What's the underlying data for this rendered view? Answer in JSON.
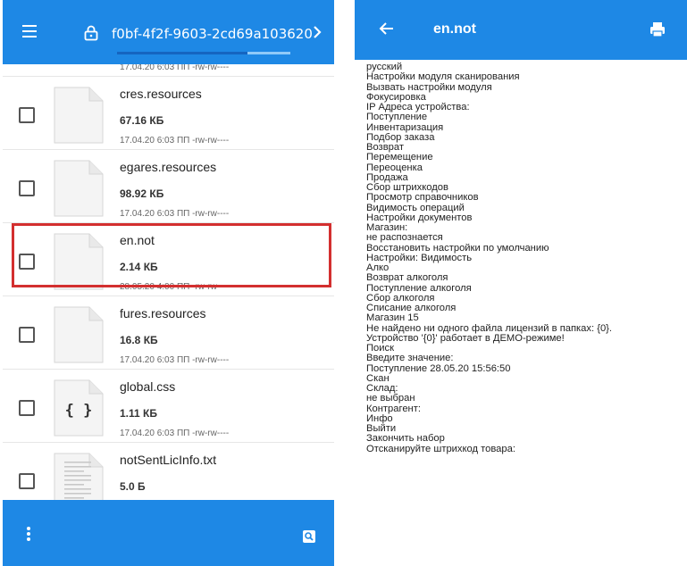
{
  "left_panel": {
    "path_text": "f0bf-4f2f-9603-2cd69a103620",
    "load_progress": 0.75,
    "partial_top_meta": "17.04.20 6:03 ПП  -rw-rw----",
    "files": [
      {
        "name": "cres.resources",
        "size": "67.16 КБ",
        "meta": "17.04.20 6:03 ПП  -rw-rw----",
        "icon": "blank-file-icon"
      },
      {
        "name": "egares.resources",
        "size": "98.92 КБ",
        "meta": "17.04.20 6:03 ПП  -rw-rw----",
        "icon": "blank-file-icon"
      },
      {
        "name": "en.not",
        "size": "2.14 КБ",
        "meta": "28.05.20 4:00 ПП  -rw-rw----",
        "icon": "blank-file-icon",
        "highlighted": true
      },
      {
        "name": "fures.resources",
        "size": "16.8 КБ",
        "meta": "17.04.20 6:03 ПП  -rw-rw----",
        "icon": "blank-file-icon"
      },
      {
        "name": "global.css",
        "size": "1.11 КБ",
        "meta": "17.04.20 6:03 ПП  -rw-rw----",
        "icon": "code-file-icon",
        "icon_glyph": "{ }"
      },
      {
        "name": "notSentLicInfo.txt",
        "size": "5.0 Б",
        "meta": "",
        "icon": "text-file-icon"
      }
    ],
    "icons": {
      "menu": "hamburger-menu-icon",
      "lock": "lock-icon",
      "next": "chevron-right-icon",
      "more": "more-vert-icon",
      "search": "search-icon"
    },
    "colors": {
      "app_bar": "#1e88e5",
      "highlight": "#d32f2f"
    }
  },
  "right_panel": {
    "title": "en.not",
    "icons": {
      "back": "arrow-back-icon",
      "print": "print-icon"
    },
    "lines": [
      "русский",
      "Настройки модуля сканирования",
      "Вызвать настройки модуля",
      "Фокусировка",
      "IP Адреса устройства:",
      "Поступление",
      "Инвентаризация",
      "Подбор заказа",
      "Возврат",
      "Перемещение",
      "Переоценка",
      "Продажа",
      "Сбор штрихкодов",
      "Просмотр справочников",
      "Видимость операций",
      "Настройки документов",
      "Магазин:",
      "не распознается",
      "Восстановить настройки по умолчанию",
      "Настройки: Видимость",
      "Алко",
      "Возврат алкоголя",
      "Поступление алкоголя",
      "Сбор алкоголя",
      "Списание алкоголя",
      "Магазин 15",
      "Не найдено ни одного файла лицензий в папках: {0}.",
      "Устройство '{0}' работает в ДЕМО-режиме!",
      "Поиск",
      "Введите значение:",
      "Поступление 28.05.20 15:56:50",
      "Скан",
      "Склад:",
      "не выбран",
      "Контрагент:",
      "Инфо",
      "Выйти",
      "Закончить набор",
      "Отсканируйте штрихкод товара:"
    ]
  }
}
